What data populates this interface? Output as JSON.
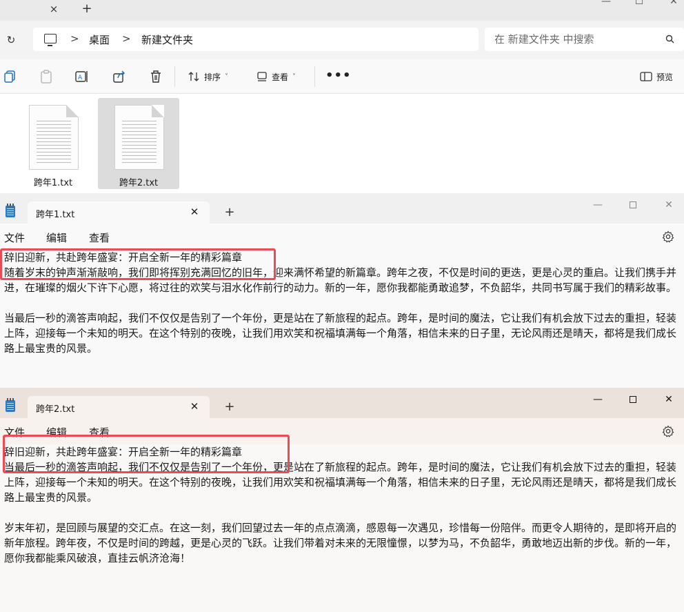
{
  "explorer": {
    "tab_close": "×",
    "tab_new": "+",
    "window": {
      "minimize": "—",
      "maximize": "☐",
      "close": "✕"
    },
    "refresh": "↻",
    "breadcrumb": [
      "桌面",
      "新建文件夹"
    ],
    "breadcrumb_sep": ">",
    "search_placeholder": "在 新建文件夹 中搜索",
    "toolbar": {
      "sort_label": "排序",
      "view_label": "查看",
      "more": "•••",
      "preview_label": "预览",
      "dropdown": "˅"
    },
    "files": [
      {
        "name": "跨年1.txt",
        "selected": false
      },
      {
        "name": "跨年2.txt",
        "selected": true
      }
    ]
  },
  "notepad1": {
    "tab_title": "跨年1.txt",
    "tab_close": "✕",
    "tab_new": "+",
    "window": {
      "minimize": "—",
      "close": "✕"
    },
    "menu": [
      "文件",
      "编辑",
      "查看"
    ],
    "content": "辞旧迎新，共赴跨年盛宴：开启全新一年的精彩篇章\n随着岁末的钟声渐渐敲响，我们即将挥别充满回忆的旧年，迎来满怀希望的新篇章。跨年之夜，不仅是时间的更迭，更是心灵的重启。让我们携手并进，在璀璨的烟火下许下心愿，将过往的欢笑与泪水化作前行的动力。新的一年，愿你我都能勇敢追梦，不负韶华，共同书写属于我们的精彩故事。\n\n当最后一秒的滴答声响起，我们不仅仅是告别了一个年份，更是站在了新旅程的起点。跨年，是时间的魔法，它让我们有机会放下过去的重担，轻装上阵，迎接每一个未知的明天。在这个特别的夜晚，让我们用欢笑和祝福填满每一个角落，相信未来的日子里，无论风雨还是晴天，都将是我们成长路上最宝贵的风景。"
  },
  "notepad2": {
    "tab_title": "跨年2.txt",
    "tab_close": "✕",
    "tab_new": "+",
    "window": {
      "minimize": "—",
      "close": "✕"
    },
    "menu": [
      "文件",
      "编辑",
      "查看"
    ],
    "content": "辞旧迎新，共赴跨年盛宴：开启全新一年的精彩篇章\n当最后一秒的滴答声响起，我们不仅仅是告别了一个年份，更是站在了新旅程的起点。跨年，是时间的魔法，它让我们有机会放下过去的重担，轻装上阵，迎接每一个未知的明天。在这个特别的夜晚，让我们用欢笑和祝福填满每一个角落，相信未来的日子里，无论风雨还是晴天，都将是我们成长路上最宝贵的风景。\n\n岁末年初，是回顾与展望的交汇点。在这一刻，我们回望过去一年的点点滴滴，感恩每一次遇见，珍惜每一份陪伴。而更令人期待的，是即将开启的新年旅程。跨年夜，不仅是时间的跨越，更是心灵的飞跃。让我们带着对未来的无限憧憬，以梦为马，不负韶华，勇敢地迈出新的步伐。新的一年，愿你我都能乘风破浪，直挂云帆济沧海！"
  },
  "colors": {
    "highlight": "#ee4a55",
    "notepad_icon": "#2b79c9"
  }
}
